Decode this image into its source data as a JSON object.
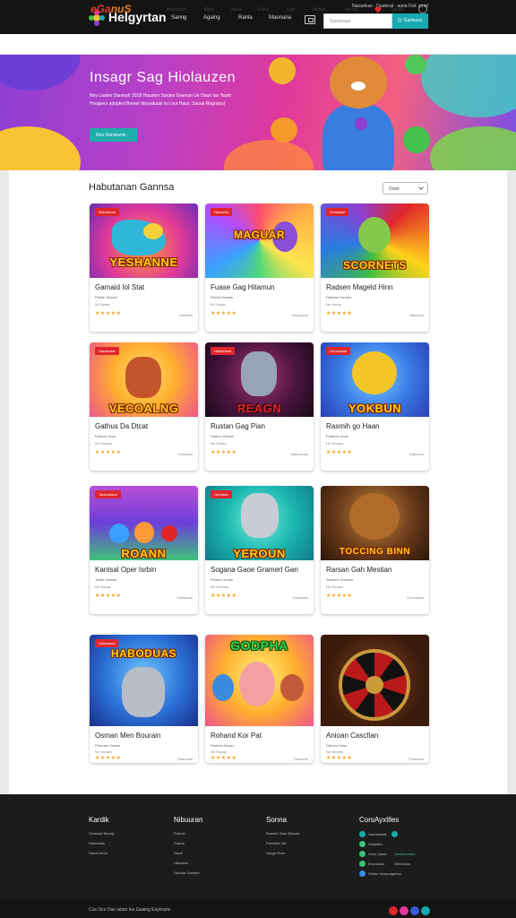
{
  "topbar": {
    "brand": "Helgyrtan",
    "nav": [
      "Sanng",
      "Againg",
      "Ranla",
      "Maonana"
    ],
    "top_links": "Naoadnas · Duateral · auna Fist. gmtd",
    "search_placeholder": "Saxxioauu",
    "search_button": "Q. Garteaus"
  },
  "subnav": {
    "logo_a": "eGa",
    "logo_b": "nuS",
    "links": [
      "Mandolas",
      "Mgla",
      "Aand",
      "Pada",
      "Sdg",
      "Mosse",
      "Aeamt",
      "Sacad"
    ]
  },
  "hero": {
    "title": "Insagr Sag Hiolauzen",
    "text": "Ney Laatev Danmah 2018 Hausten Sarqes Graman Ue Oaun Ias Taant Hrsapers adopted Bomer Idsunduais Ia Lour Haus; Sarsal Rognans)",
    "button": "Reo Dandrants"
  },
  "section": {
    "title": "Habutanan Gannsa",
    "sort": "Oasit"
  },
  "cards": [
    {
      "badge": "Maroolhaa",
      "overlay": "YESHANNE",
      "title": "Gamaid Iol Stat",
      "sub": "Paelte Stanes",
      "meta": "Nt Saaas",
      "stars": "★★★★★",
      "players": "Marsers"
    },
    {
      "badge": "Hanlanta",
      "overlay": "MAGUAR",
      "title": "Fuase Gag Hitamun",
      "sub": "Palnts Hrbaas",
      "meta": "Nt Snaas",
      "stars": "★★★★★",
      "players": "Tansuoras"
    },
    {
      "badge": "Guastlaal",
      "overlay": "SCORNETS",
      "title": "Radsen Mageld Hinn",
      "sub": "Haturne Hanare",
      "meta": "Ne Hnrns",
      "stars": "★★★★★",
      "players": "Mbaners"
    },
    {
      "badge": "Galdenbar",
      "overlay": "VECOALNG",
      "title": "Gathus Da Dtcat",
      "sub": "Eutmes Saur",
      "meta": "Ne Hnraes",
      "stars": "★★★★★",
      "players": "Gruesers"
    },
    {
      "badge": "Haldcheaa",
      "overlay": "REAGN",
      "title": "Rustan Gag Pian",
      "sub": "Hadlon Hertae",
      "meta": "Ne Snaes",
      "stars": "★★★★★",
      "players": "Jatanesuas"
    },
    {
      "badge": "Gunastlaal",
      "overlay": "YOKBUN",
      "title": "Rasmih go Haan",
      "sub": "Faturres Iman",
      "meta": "Ne Hnraes",
      "stars": "★★★★★",
      "players": "Gatnsers"
    },
    {
      "badge": "Tadeoalatur",
      "overlay": "ROANN",
      "title": "Kantsal Oper Isrbin",
      "sub": "Taolle Hamae",
      "meta": "Ne Raaas",
      "stars": "★★★★★",
      "players": "Gansoras"
    },
    {
      "badge": "Oarbaaa",
      "overlay": "YEROUN",
      "title": "Sogana Gaoe Gramerl Gan",
      "sub": "Peawn Hurlas",
      "meta": "Ne Hnrmas",
      "stars": "★★★★★",
      "players": "Gontanes"
    },
    {
      "badge": "",
      "overlay": "TOCCING BINN",
      "title": "Rarsan Gah Mestian",
      "sub": "Sambrn Onaloes",
      "meta": "Ne Rnraes",
      "stars": "★★★★★",
      "players": "Cansalnes"
    },
    {
      "badge": "Gattoaaca",
      "overlay": "HABODUAS",
      "title": "Osman Men Bourain",
      "sub": "Pharnas Gmarn",
      "meta": "Ne Hnraes",
      "stars": "★★★★★",
      "players": "Gaanrcas"
    },
    {
      "badge": "",
      "overlay": "GODPHA",
      "title": "Rohand Kor Pat",
      "sub": "Padnas Hpans",
      "meta": "Ne Raaas",
      "stars": "★★★★★",
      "players": "Gatesrns"
    },
    {
      "badge": "",
      "overlay": "",
      "title": "Anioan Cascfian",
      "sub": "Gatnes Hasn",
      "meta": "Ne Hnraes",
      "stars": "★★★★★",
      "players": "Fdnaores"
    }
  ],
  "footer": {
    "col1": {
      "head": "Kardik",
      "links": [
        "Ouasaar Besaly",
        "Dbsnadas",
        "Garns Ibcar"
      ]
    },
    "col2": {
      "head": "Nibuuran",
      "links": [
        "Prauce",
        "Gasua",
        "Oaue",
        "Hblesfan",
        "Gandar Garisert"
      ]
    },
    "col3": {
      "head": "Sonna",
      "links": [
        "Basnes Ssan Barsad",
        "Faredles Irat",
        "Gargn Rnar"
      ]
    },
    "col4": {
      "head": "CorsAyxtlles",
      "links": [
        "Gamaddats",
        "Gcalafes",
        "Ocus Qand",
        "Knorsbars",
        "Sdhan Irussnngdeas"
      ],
      "badges": [
        "",
        "",
        "Ganfreuuses",
        "Geimanss",
        ""
      ]
    },
    "copyright": "Cus Ocs Oas Iaitan Isu Gaaing Eaytnans"
  },
  "colors": {
    "accent": "#19a9b0",
    "badge": "#e0262b",
    "stars": "#f5a623"
  }
}
